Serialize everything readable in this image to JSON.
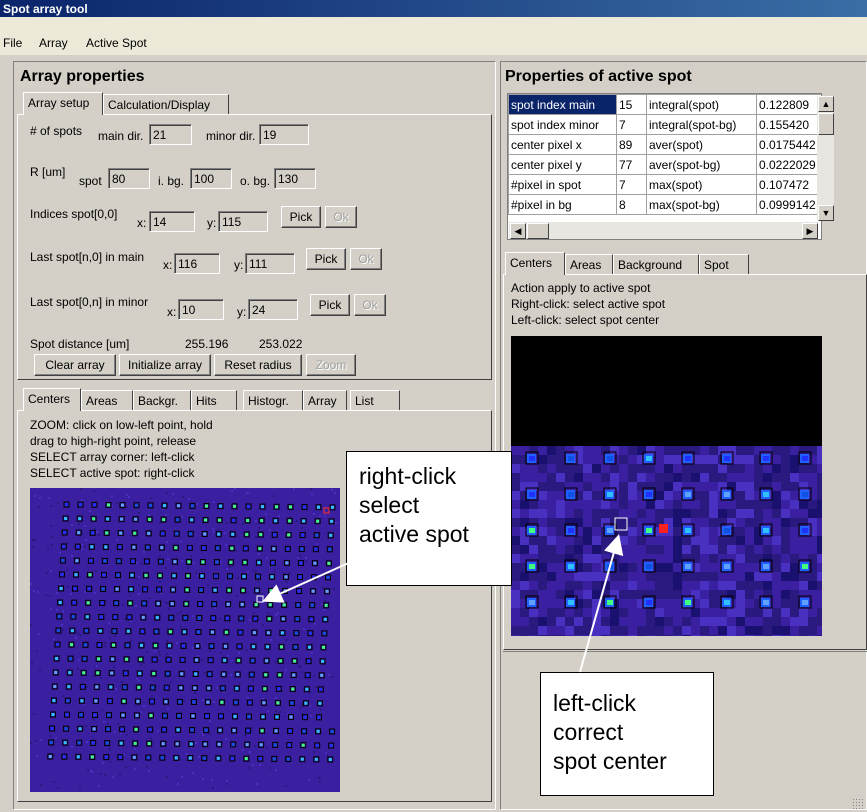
{
  "window": {
    "title": "Spot array tool"
  },
  "menu": [
    "File",
    "Array",
    "Active Spot"
  ],
  "array_properties": {
    "title": "Array properties",
    "tabs": [
      "Array setup",
      "Calculation/Display"
    ],
    "num_spots_label": "# of spots",
    "main_dir_label": "main dir.",
    "main_dir_value": "21",
    "minor_dir_label": "minor dir.",
    "minor_dir_value": "19",
    "r_label": "R [um]",
    "spot_label": "spot",
    "spot_value": "80",
    "ibg_label": "i. bg.",
    "ibg_value": "100",
    "obg_label": "o. bg.",
    "obg_value": "130",
    "indices_label": "Indices spot[0,0]",
    "indices_x": "14",
    "indices_y": "115",
    "last_main_label": "Last spot[n,0] in main",
    "last_main_x": "116",
    "last_main_y": "111",
    "last_minor_label": "Last spot[0,n] in minor",
    "last_minor_x": "10",
    "last_minor_y": "24",
    "x_label": "x:",
    "y_label": "y:",
    "pick_label": "Pick",
    "ok_label": "Ok",
    "spot_distance_label": "Spot distance [um]",
    "spot_distance_1": "255.196",
    "spot_distance_2": "253.022",
    "clear_array": "Clear array",
    "initialize_array": "Initialize array",
    "reset_radius": "Reset radius",
    "zoom": "Zoom"
  },
  "display": {
    "tabs": [
      "Centers",
      "Areas",
      "Backgr.",
      "Hits",
      "Histogr.",
      "Array",
      "List"
    ],
    "instructions": [
      "ZOOM: click on low-left point, hold",
      "drag to high-right point, release",
      "SELECT array corner: left-click",
      "SELECT active spot: right-click"
    ]
  },
  "active_spot": {
    "title": "Properties of active spot",
    "rows": [
      [
        "spot index main",
        "15",
        "integral(spot)",
        "0.122809"
      ],
      [
        "spot index minor",
        "7",
        "integral(spot-bg)",
        "0.155420"
      ],
      [
        "center pixel x",
        "89",
        "aver(spot)",
        "0.0175442"
      ],
      [
        "center pixel y",
        "77",
        "aver(spot-bg)",
        "0.0222029"
      ],
      [
        "#pixel in spot",
        "7",
        "max(spot)",
        "0.107472"
      ],
      [
        "#pixel in bg",
        "8",
        "max(spot-bg)",
        "0.0999142"
      ]
    ],
    "tabs": [
      "Centers",
      "Areas",
      "Background",
      "Spot"
    ],
    "instructions": [
      "Action apply to active spot",
      "Right-click: select active spot",
      "Left-click: select spot center"
    ]
  },
  "callouts": {
    "right": [
      "right-click",
      "select",
      "active spot"
    ],
    "left": [
      "left-click",
      "correct",
      "spot center"
    ]
  },
  "colors": {
    "title_bar": "#0a246a",
    "selection": "#0a246a",
    "image_background": "#3a20a0",
    "spot_marker": "#000000",
    "active_marker": "#ffffff"
  }
}
